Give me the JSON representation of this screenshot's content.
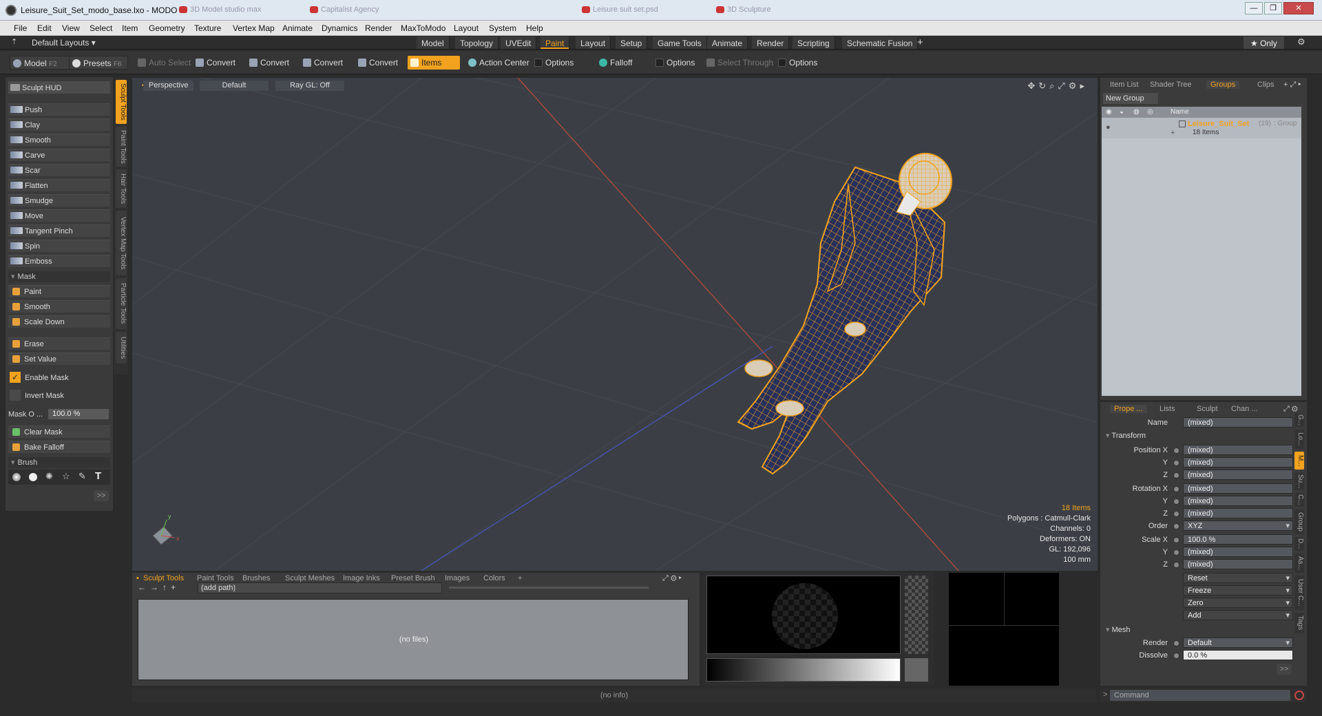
{
  "window": {
    "title": "Leisure_Suit_Set_modo_base.lxo - MODO",
    "ghost_tabs": [
      "3D Model studio max",
      "Capitalist Agency",
      "Leisure suit set.psd",
      "3D Sculpture"
    ],
    "controls": [
      "—",
      "❐",
      "✕"
    ]
  },
  "menu": [
    "File",
    "Edit",
    "View",
    "Select",
    "Item",
    "Geometry",
    "Texture",
    "Vertex Map",
    "Animate",
    "Dynamics",
    "Render",
    "MaxToModo",
    "Layout",
    "System",
    "Help"
  ],
  "layoutbar": {
    "layout_select": "Default Layouts ▾",
    "tabs": [
      "Model",
      "Topology",
      "UVEdit",
      "Paint",
      "Layout",
      "Setup",
      "Game Tools",
      "Animate",
      "Render",
      "Scripting",
      "Schematic Fusion"
    ],
    "active_tab": "Paint",
    "add_label": "+",
    "only_label": "★  Only"
  },
  "toolbar": {
    "model": "Model",
    "model_key": "F2",
    "presets": "Presets",
    "presets_key": "F6",
    "auto_select": "Auto Select",
    "convert": [
      "Convert",
      "Convert",
      "Convert",
      "Convert"
    ],
    "items": "Items",
    "action_center": "Action Center",
    "options1": "Options",
    "falloff": "Falloff",
    "options2": "Options",
    "select_through": "Select Through",
    "options3": "Options"
  },
  "sculpt": {
    "hud": "Sculpt HUD",
    "tools": [
      "Push",
      "Clay",
      "Smooth",
      "Carve",
      "Scar",
      "Flatten",
      "Smudge",
      "Move",
      "Tangent Pinch",
      "Spin",
      "Emboss"
    ],
    "mask_section": "Mask",
    "mask_tools": [
      "Paint",
      "Smooth",
      "Scale Down"
    ],
    "erase": "Erase",
    "set_value": "Set Value",
    "enable_mask": "Enable Mask",
    "invert_mask": "Invert Mask",
    "mask_opacity_label": "Mask O ...",
    "mask_opacity_value": "100.0 %",
    "clear_mask": "Clear Mask",
    "bake_falloff": "Bake Falloff",
    "brush_section": "Brush",
    "more": ">>"
  },
  "vertical_tabs": [
    "Sculpt Tools",
    "Paint Tools",
    "Hair Tools",
    "Vertex Map Tools",
    "Particle Tools",
    "Utilities"
  ],
  "viewport": {
    "view": "Perspective",
    "shading": "Default",
    "raygl": "Ray GL: Off",
    "stats": {
      "items": "18 Items",
      "polygons": "Polygons : Catmull-Clark",
      "channels": "Channels: 0",
      "deformers": "Deformers: ON",
      "gl": "GL: 192,096",
      "size": "100 mm"
    },
    "colors": {
      "x_axis": "#c24a3c",
      "z_axis": "#4a56c2",
      "selection": "#f2a21f",
      "mesh": "#27305a"
    }
  },
  "bottom": {
    "tabs": [
      "Sculpt Tools",
      "Paint Tools",
      "Brushes",
      "Sculpt Meshes",
      "Image Inks",
      "Preset Brush",
      "Images",
      "Colors"
    ],
    "add": "+",
    "path": "(add path)",
    "no_files": "(no files)",
    "no_info": "(no info)"
  },
  "items_panel": {
    "tabs": [
      "Item List",
      "Shader Tree",
      "Groups",
      "Clips"
    ],
    "active_tab": "Groups",
    "new_group": "New Group",
    "header_name": "Name",
    "group_name": "Leisure_Suit_Set",
    "group_count": "(19)",
    "group_type": ": Group",
    "group_sub": "18 Items"
  },
  "properties": {
    "tabs": [
      "Prope ...",
      "Lists",
      "Sculpt",
      "Chan ..."
    ],
    "name_label": "Name",
    "name_value": "(mixed)",
    "transform": "Transform",
    "position_label": "Position X",
    "rotation_label": "Rotation X",
    "scale_label": "Scale X",
    "y": "Y",
    "z": "Z",
    "mixed": "(mixed)",
    "order_label": "Order",
    "order_value": "XYZ",
    "scale_x": "100.0 %",
    "reset": "Reset",
    "freeze": "Freeze",
    "zero": "Zero",
    "add": "Add",
    "mesh": "Mesh",
    "render_label": "Render",
    "render_value": "Default",
    "dissolve_label": "Dissolve",
    "dissolve_value": "0.0 %",
    "more": ">>",
    "side_tabs": [
      "G...",
      "Lo...",
      "M...",
      "Su...",
      "C...",
      "Group",
      "D...",
      "As...",
      "User C...",
      "Tags"
    ]
  },
  "command": {
    "prompt": ">",
    "placeholder": "Command"
  }
}
